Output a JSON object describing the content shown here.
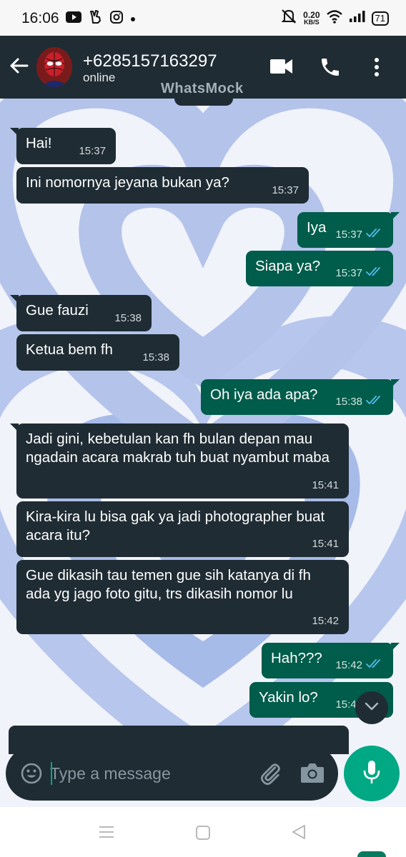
{
  "status_bar": {
    "time": "16:06",
    "net_speed_value": "0.20",
    "net_speed_unit": "KB/S",
    "battery": "71",
    "icons": [
      "youtube-icon",
      "peace-hand-icon",
      "instagram-icon",
      "dot-icon",
      "mute-icon",
      "wifi-icon",
      "signal-icon",
      "battery-icon"
    ]
  },
  "header": {
    "contact_name": "+6285157163297",
    "status": "online",
    "watermark": "WhatsMock",
    "icons": [
      "back-arrow-icon",
      "avatar",
      "video-call-icon",
      "phone-icon",
      "more-vertical-icon"
    ]
  },
  "messages": [
    {
      "dir": "in",
      "text": "Hai!",
      "time": "15:37"
    },
    {
      "dir": "in",
      "text": "Ini nomornya jeyana bukan ya?",
      "time": "15:37"
    },
    {
      "dir": "out",
      "text": "Iya",
      "time": "15:37",
      "read": true
    },
    {
      "dir": "out",
      "text": "Siapa ya?",
      "time": "15:37",
      "read": true
    },
    {
      "dir": "in",
      "text": "Gue fauzi",
      "time": "15:38"
    },
    {
      "dir": "in",
      "text": "Ketua bem fh",
      "time": "15:38"
    },
    {
      "dir": "out",
      "text": "Oh iya ada apa?",
      "time": "15:38",
      "read": true
    },
    {
      "dir": "in",
      "text": "Jadi gini, kebetulan kan fh bulan depan mau ngadain acara makrab tuh buat nyambut maba",
      "time": "15:41"
    },
    {
      "dir": "in",
      "text": "Kira-kira lu bisa gak ya jadi photographer buat acara itu?",
      "time": "15:41"
    },
    {
      "dir": "in",
      "text": "Gue dikasih tau temen gue sih katanya di fh ada yg jago foto gitu, trs dikasih nomor lu",
      "time": "15:42"
    },
    {
      "dir": "out",
      "text": "Hah???",
      "time": "15:42",
      "read": true
    },
    {
      "dir": "out",
      "text": "Yakin lo?",
      "time": "15:42",
      "read": true
    }
  ],
  "input": {
    "placeholder": "Type a message"
  },
  "colors": {
    "header_bg": "#1f2c34",
    "incoming_bubble": "#1f2c34",
    "outgoing_bubble": "#005c4b",
    "accent": "#00a884",
    "read_tick": "#53bdeb",
    "wallpaper_blue": "#a9bde9"
  }
}
